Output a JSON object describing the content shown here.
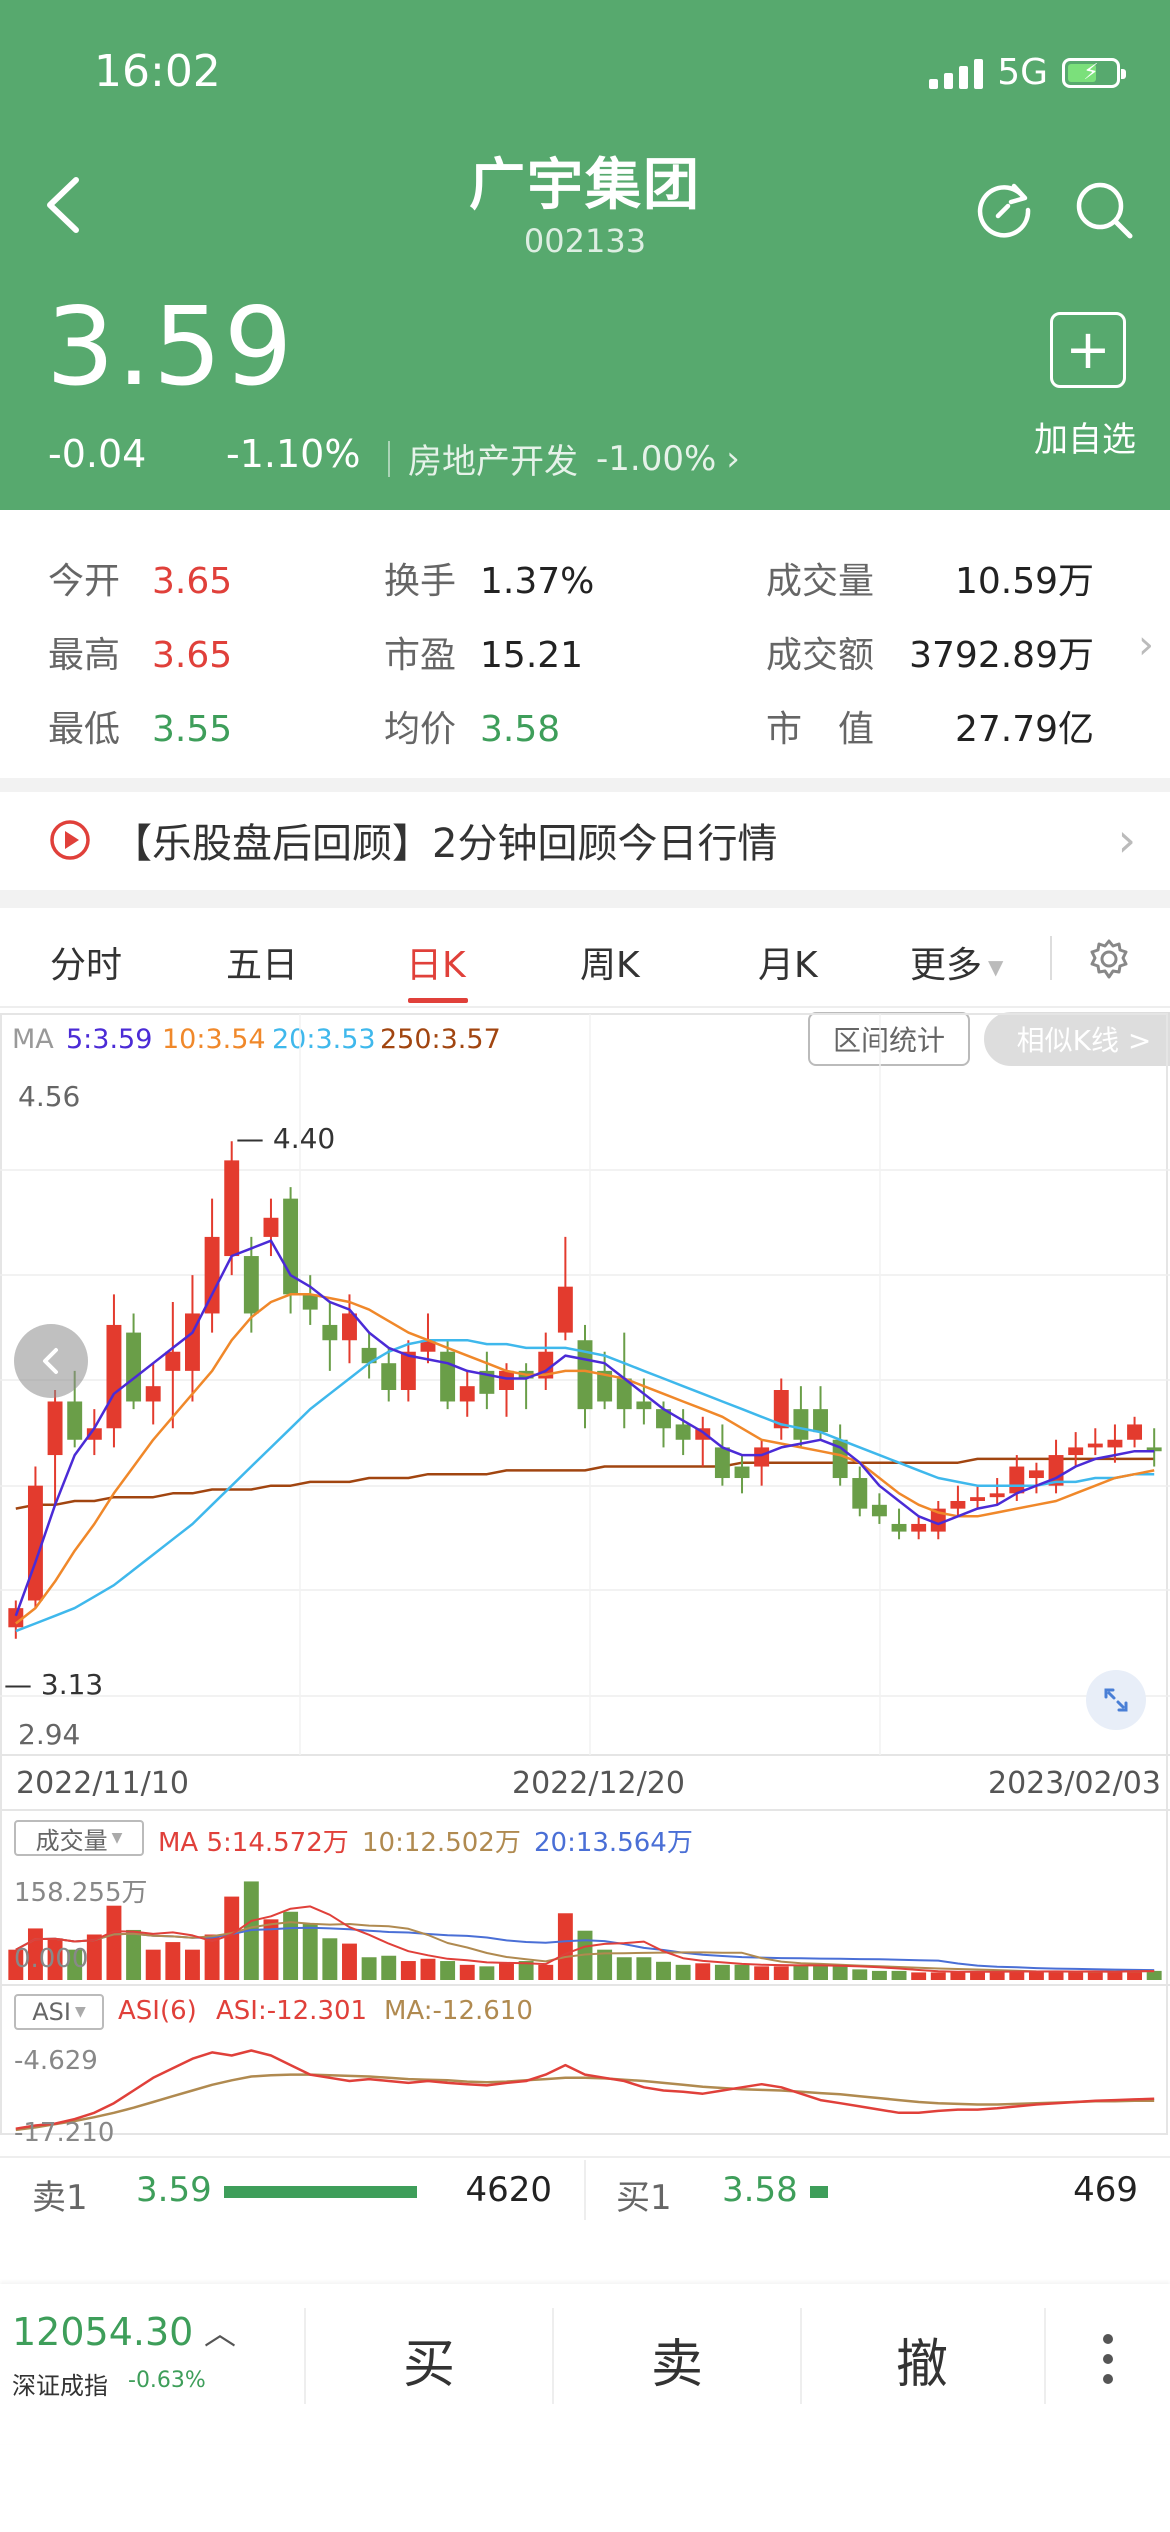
{
  "status": {
    "time": "16:02",
    "network": "5G"
  },
  "header": {
    "title": "广宇集团",
    "code": "002133",
    "price": "3.59",
    "change": "-0.04",
    "change_pct": "-1.10%",
    "sector_name": "房地产开发",
    "sector_pct": "-1.00%",
    "add_watch": "加自选",
    "bg_color": "#57a96e"
  },
  "stats": [
    {
      "label": "今开",
      "value": "3.65",
      "color": "red"
    },
    {
      "label": "最高",
      "value": "3.65",
      "color": "red"
    },
    {
      "label": "最低",
      "value": "3.55",
      "color": "green"
    },
    {
      "label": "换手",
      "value": "1.37%",
      "color": "dark"
    },
    {
      "label": "市盈",
      "value": "15.21",
      "color": "dark"
    },
    {
      "label": "均价",
      "value": "3.58",
      "color": "green"
    },
    {
      "label": "成交量",
      "value": "10.59万",
      "color": "dark"
    },
    {
      "label": "成交额",
      "value": "3792.89万",
      "color": "dark"
    },
    {
      "label": "市　值",
      "value": "27.79亿",
      "color": "dark"
    }
  ],
  "news": {
    "text": "【乐股盘后回顾】2分钟回顾今日行情"
  },
  "tabs": [
    {
      "label": "分时"
    },
    {
      "label": "五日"
    },
    {
      "label": "日K",
      "active": true
    },
    {
      "label": "周K"
    },
    {
      "label": "月K"
    },
    {
      "label": "更多"
    }
  ],
  "ma_legend": {
    "prefix": "MA",
    "ma5": "5:3.59",
    "ma10": "10:3.54",
    "ma20": "20:3.53",
    "ma250": "250:3.57"
  },
  "chart_buttons": {
    "range_stats": "区间统计",
    "similar_k": "相似K线 >"
  },
  "price_axis": {
    "top": "4.56",
    "bottom": "2.94",
    "high_mark": "4.40",
    "low_mark": "3.13"
  },
  "dates": [
    "2022/11/10",
    "2022/12/20",
    "2023/02/03"
  ],
  "volume_legend": {
    "selector": "成交量",
    "ma5": "MA 5:14.572万",
    "ma10": "10:12.502万",
    "ma20": "20:13.564万",
    "max": "158.255万",
    "min": "0.000"
  },
  "asi_legend": {
    "selector": "ASI",
    "asi6": "ASI(6)",
    "asi": "ASI:-12.301",
    "ma": "MA:-12.610",
    "top": "-4.629",
    "bottom": "-17.210"
  },
  "orders": {
    "sell": {
      "label": "卖1",
      "price": "3.59",
      "qty": "4620",
      "bar_fraction": 0.21
    },
    "buy": {
      "label": "买1",
      "price": "3.58",
      "qty": "469",
      "bar_fraction": 0.02
    }
  },
  "index": {
    "value": "12054.30",
    "name": "深证成指",
    "pct": "-0.63%"
  },
  "actions": {
    "buy": "买",
    "sell": "卖",
    "cancel": "撤"
  },
  "chart_data": {
    "type": "candlestick",
    "x_labels": [
      "2022/11/10",
      "2022/12/20",
      "2023/02/03"
    ],
    "ylim": [
      2.94,
      4.56
    ],
    "candles": [
      {
        "o": 3.13,
        "h": 3.2,
        "l": 3.1,
        "c": 3.18
      },
      {
        "o": 3.2,
        "h": 3.55,
        "l": 3.18,
        "c": 3.5
      },
      {
        "o": 3.58,
        "h": 3.75,
        "l": 3.45,
        "c": 3.72
      },
      {
        "o": 3.72,
        "h": 3.8,
        "l": 3.6,
        "c": 3.62
      },
      {
        "o": 3.62,
        "h": 3.7,
        "l": 3.58,
        "c": 3.65
      },
      {
        "o": 3.65,
        "h": 4.0,
        "l": 3.6,
        "c": 3.92
      },
      {
        "o": 3.9,
        "h": 3.95,
        "l": 3.7,
        "c": 3.72
      },
      {
        "o": 3.72,
        "h": 3.82,
        "l": 3.66,
        "c": 3.76
      },
      {
        "o": 3.8,
        "h": 3.98,
        "l": 3.65,
        "c": 3.85
      },
      {
        "o": 3.8,
        "h": 4.05,
        "l": 3.72,
        "c": 3.95
      },
      {
        "o": 3.95,
        "h": 4.25,
        "l": 3.9,
        "c": 4.15
      },
      {
        "o": 4.1,
        "h": 4.4,
        "l": 4.05,
        "c": 4.35
      },
      {
        "o": 4.1,
        "h": 4.15,
        "l": 3.9,
        "c": 3.95
      },
      {
        "o": 4.15,
        "h": 4.25,
        "l": 4.1,
        "c": 4.2
      },
      {
        "o": 4.25,
        "h": 4.28,
        "l": 3.95,
        "c": 4.0
      },
      {
        "o": 4.0,
        "h": 4.05,
        "l": 3.92,
        "c": 3.96
      },
      {
        "o": 3.92,
        "h": 3.98,
        "l": 3.8,
        "c": 3.88
      },
      {
        "o": 3.88,
        "h": 4.0,
        "l": 3.82,
        "c": 3.95
      },
      {
        "o": 3.86,
        "h": 3.9,
        "l": 3.78,
        "c": 3.82
      },
      {
        "o": 3.82,
        "h": 3.86,
        "l": 3.72,
        "c": 3.75
      },
      {
        "o": 3.75,
        "h": 3.88,
        "l": 3.72,
        "c": 3.85
      },
      {
        "o": 3.85,
        "h": 3.95,
        "l": 3.82,
        "c": 3.88
      },
      {
        "o": 3.85,
        "h": 3.88,
        "l": 3.7,
        "c": 3.72
      },
      {
        "o": 3.72,
        "h": 3.8,
        "l": 3.68,
        "c": 3.76
      },
      {
        "o": 3.8,
        "h": 3.85,
        "l": 3.7,
        "c": 3.74
      },
      {
        "o": 3.75,
        "h": 3.82,
        "l": 3.68,
        "c": 3.8
      },
      {
        "o": 3.8,
        "h": 3.82,
        "l": 3.7,
        "c": 3.78
      },
      {
        "o": 3.78,
        "h": 3.9,
        "l": 3.75,
        "c": 3.85
      },
      {
        "o": 3.9,
        "h": 4.15,
        "l": 3.88,
        "c": 4.02
      },
      {
        "o": 3.88,
        "h": 3.92,
        "l": 3.65,
        "c": 3.7
      },
      {
        "o": 3.8,
        "h": 3.85,
        "l": 3.7,
        "c": 3.72
      },
      {
        "o": 3.78,
        "h": 3.9,
        "l": 3.65,
        "c": 3.7
      },
      {
        "o": 3.72,
        "h": 3.78,
        "l": 3.66,
        "c": 3.7
      },
      {
        "o": 3.7,
        "h": 3.72,
        "l": 3.6,
        "c": 3.65
      },
      {
        "o": 3.66,
        "h": 3.7,
        "l": 3.58,
        "c": 3.62
      },
      {
        "o": 3.62,
        "h": 3.68,
        "l": 3.55,
        "c": 3.65
      },
      {
        "o": 3.6,
        "h": 3.66,
        "l": 3.5,
        "c": 3.52
      },
      {
        "o": 3.55,
        "h": 3.58,
        "l": 3.48,
        "c": 3.52
      },
      {
        "o": 3.55,
        "h": 3.62,
        "l": 3.5,
        "c": 3.6
      },
      {
        "o": 3.65,
        "h": 3.78,
        "l": 3.62,
        "c": 3.75
      },
      {
        "o": 3.7,
        "h": 3.76,
        "l": 3.6,
        "c": 3.62
      },
      {
        "o": 3.7,
        "h": 3.76,
        "l": 3.62,
        "c": 3.64
      },
      {
        "o": 3.62,
        "h": 3.66,
        "l": 3.5,
        "c": 3.52
      },
      {
        "o": 3.52,
        "h": 3.55,
        "l": 3.42,
        "c": 3.44
      },
      {
        "o": 3.45,
        "h": 3.48,
        "l": 3.4,
        "c": 3.42
      },
      {
        "o": 3.4,
        "h": 3.44,
        "l": 3.36,
        "c": 3.38
      },
      {
        "o": 3.38,
        "h": 3.42,
        "l": 3.36,
        "c": 3.4
      },
      {
        "o": 3.38,
        "h": 3.46,
        "l": 3.36,
        "c": 3.44
      },
      {
        "o": 3.44,
        "h": 3.5,
        "l": 3.42,
        "c": 3.46
      },
      {
        "o": 3.46,
        "h": 3.5,
        "l": 3.44,
        "c": 3.47
      },
      {
        "o": 3.47,
        "h": 3.52,
        "l": 3.45,
        "c": 3.48
      },
      {
        "o": 3.48,
        "h": 3.58,
        "l": 3.46,
        "c": 3.55
      },
      {
        "o": 3.52,
        "h": 3.56,
        "l": 3.48,
        "c": 3.54
      },
      {
        "o": 3.5,
        "h": 3.62,
        "l": 3.48,
        "c": 3.58
      },
      {
        "o": 3.58,
        "h": 3.64,
        "l": 3.55,
        "c": 3.6
      },
      {
        "o": 3.6,
        "h": 3.65,
        "l": 3.58,
        "c": 3.61
      },
      {
        "o": 3.6,
        "h": 3.66,
        "l": 3.56,
        "c": 3.62
      },
      {
        "o": 3.62,
        "h": 3.68,
        "l": 3.6,
        "c": 3.66
      },
      {
        "o": 3.6,
        "h": 3.65,
        "l": 3.55,
        "c": 3.59
      }
    ],
    "ma5": [
      3.16,
      3.3,
      3.45,
      3.58,
      3.65,
      3.74,
      3.78,
      3.82,
      3.86,
      3.9,
      4.0,
      4.1,
      4.12,
      4.14,
      4.05,
      4.02,
      3.98,
      3.96,
      3.9,
      3.86,
      3.84,
      3.83,
      3.82,
      3.8,
      3.79,
      3.78,
      3.78,
      3.8,
      3.84,
      3.83,
      3.82,
      3.78,
      3.74,
      3.7,
      3.67,
      3.64,
      3.6,
      3.58,
      3.58,
      3.6,
      3.61,
      3.62,
      3.6,
      3.56,
      3.5,
      3.46,
      3.42,
      3.4,
      3.42,
      3.44,
      3.45,
      3.48,
      3.5,
      3.52,
      3.55,
      3.57,
      3.58,
      3.59,
      3.59
    ],
    "ma10": [
      3.14,
      3.18,
      3.25,
      3.33,
      3.4,
      3.48,
      3.55,
      3.62,
      3.68,
      3.74,
      3.8,
      3.88,
      3.94,
      3.98,
      4.0,
      4.0,
      3.99,
      3.98,
      3.96,
      3.93,
      3.9,
      3.88,
      3.86,
      3.84,
      3.82,
      3.8,
      3.79,
      3.79,
      3.8,
      3.8,
      3.79,
      3.78,
      3.76,
      3.74,
      3.72,
      3.7,
      3.68,
      3.65,
      3.62,
      3.61,
      3.6,
      3.59,
      3.58,
      3.56,
      3.52,
      3.48,
      3.45,
      3.43,
      3.42,
      3.42,
      3.43,
      3.44,
      3.45,
      3.46,
      3.48,
      3.5,
      3.52,
      3.53,
      3.54
    ],
    "ma20": [
      3.12,
      3.14,
      3.16,
      3.18,
      3.21,
      3.24,
      3.28,
      3.32,
      3.36,
      3.4,
      3.45,
      3.5,
      3.55,
      3.6,
      3.65,
      3.7,
      3.74,
      3.78,
      3.82,
      3.85,
      3.87,
      3.88,
      3.88,
      3.88,
      3.87,
      3.87,
      3.86,
      3.86,
      3.86,
      3.85,
      3.84,
      3.82,
      3.8,
      3.78,
      3.76,
      3.74,
      3.72,
      3.7,
      3.68,
      3.66,
      3.65,
      3.64,
      3.62,
      3.6,
      3.58,
      3.56,
      3.54,
      3.52,
      3.51,
      3.5,
      3.5,
      3.5,
      3.5,
      3.51,
      3.51,
      3.52,
      3.52,
      3.53,
      3.53
    ],
    "ma250": [
      3.44,
      3.45,
      3.45,
      3.46,
      3.46,
      3.47,
      3.47,
      3.47,
      3.48,
      3.48,
      3.49,
      3.49,
      3.49,
      3.5,
      3.5,
      3.51,
      3.51,
      3.51,
      3.52,
      3.52,
      3.52,
      3.53,
      3.53,
      3.53,
      3.53,
      3.54,
      3.54,
      3.54,
      3.54,
      3.54,
      3.55,
      3.55,
      3.55,
      3.55,
      3.55,
      3.55,
      3.55,
      3.56,
      3.56,
      3.56,
      3.56,
      3.56,
      3.56,
      3.56,
      3.56,
      3.56,
      3.56,
      3.56,
      3.56,
      3.57,
      3.57,
      3.57,
      3.57,
      3.57,
      3.57,
      3.57,
      3.57,
      3.57,
      3.57
    ],
    "volume": [
      40,
      68,
      55,
      40,
      60,
      98,
      66,
      40,
      50,
      40,
      60,
      110,
      130,
      80,
      90,
      75,
      55,
      48,
      30,
      32,
      25,
      28,
      25,
      20,
      18,
      22,
      25,
      20,
      88,
      65,
      40,
      30,
      30,
      24,
      20,
      22,
      20,
      20,
      18,
      18,
      20,
      20,
      18,
      14,
      12,
      12,
      10,
      10,
      11,
      12,
      11,
      12,
      10,
      12,
      11,
      12,
      10,
      14,
      12
    ],
    "vol_max": 158.255,
    "asi": [
      -17.0,
      -16.5,
      -16.2,
      -15.5,
      -14.5,
      -13.0,
      -11.0,
      -9.0,
      -7.5,
      -6.0,
      -5.0,
      -5.5,
      -4.7,
      -5.5,
      -7.0,
      -8.5,
      -9.0,
      -9.5,
      -9.2,
      -9.5,
      -9.8,
      -9.5,
      -9.8,
      -10.0,
      -10.2,
      -9.8,
      -9.5,
      -8.5,
      -7.0,
      -8.5,
      -9.0,
      -9.5,
      -10.5,
      -11.0,
      -11.2,
      -11.5,
      -11.0,
      -10.5,
      -10.0,
      -10.5,
      -11.5,
      -12.5,
      -13.0,
      -13.5,
      -14.0,
      -14.5,
      -14.5,
      -14.2,
      -14.0,
      -14.0,
      -13.8,
      -13.5,
      -13.2,
      -13.0,
      -12.8,
      -12.6,
      -12.5,
      -12.4,
      -12.3
    ],
    "asi_ma": [
      -17.2,
      -16.8,
      -16.3,
      -15.8,
      -15.2,
      -14.5,
      -13.7,
      -12.8,
      -11.9,
      -11.0,
      -10.1,
      -9.4,
      -8.8,
      -8.6,
      -8.5,
      -8.5,
      -8.6,
      -8.7,
      -8.8,
      -9.0,
      -9.2,
      -9.3,
      -9.4,
      -9.6,
      -9.7,
      -9.6,
      -9.4,
      -9.2,
      -9.0,
      -9.0,
      -9.1,
      -9.3,
      -9.5,
      -9.8,
      -10.1,
      -10.4,
      -10.6,
      -10.8,
      -10.9,
      -11.0,
      -11.2,
      -11.4,
      -11.6,
      -11.9,
      -12.2,
      -12.5,
      -12.8,
      -13.0,
      -13.1,
      -13.2,
      -13.2,
      -13.1,
      -13.0,
      -12.9,
      -12.8,
      -12.7,
      -12.7,
      -12.6,
      -12.6
    ],
    "asi_ylim": [
      -17.21,
      -4.629
    ]
  }
}
